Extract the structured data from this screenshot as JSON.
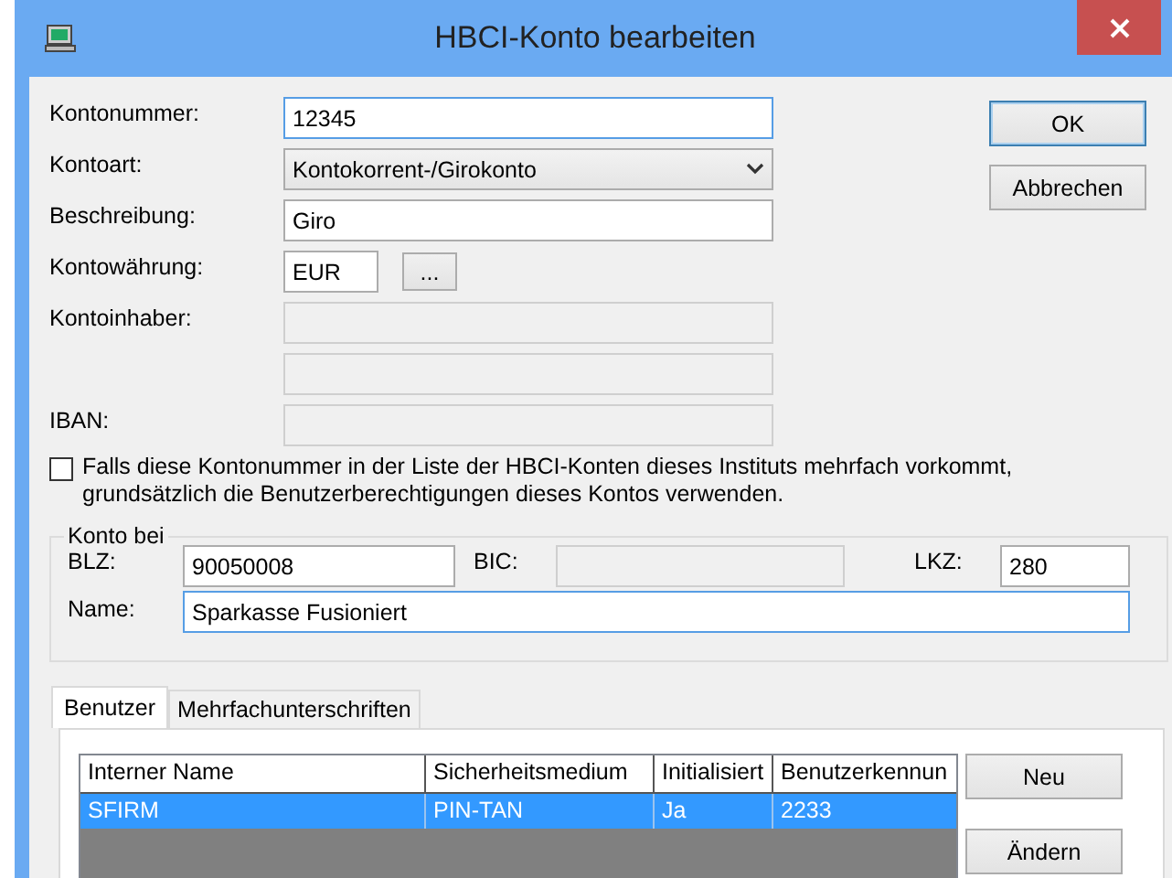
{
  "window": {
    "title": "HBCI-Konto bearbeiten"
  },
  "fields": [
    {
      "label": "Kontonummer:",
      "kind": "text",
      "value": "12345",
      "focused": true
    },
    {
      "label": "Kontoart:",
      "kind": "dropdown",
      "value": "Kontokorrent-/Girokonto",
      "focused": false
    },
    {
      "label": "Beschreibung:",
      "kind": "text",
      "value": "Giro",
      "focused": false
    },
    {
      "label": "Kontowährung:",
      "kind": "currency",
      "value": "EUR",
      "button": "...",
      "focused": false
    },
    {
      "label": "Kontoinhaber:",
      "kind": "disabled",
      "focused": false
    },
    {
      "kind": "disabled",
      "focused": false
    },
    {
      "label": "IBAN:",
      "kind": "disabled",
      "focused": false
    }
  ],
  "dialog_buttons": [
    {
      "label": "OK",
      "default": true
    },
    {
      "label": "Abbrechen",
      "default": false
    }
  ],
  "checkbox": {
    "label": "Falls diese Kontonummer in der Liste der HBCI-Konten dieses Instituts mehrfach vorkommt, grundsätzlich die Benutzerberechtigungen dieses Kontos verwenden.",
    "checked": false
  },
  "konto_bei": {
    "title": "Konto bei",
    "fields": [
      {
        "label": "BLZ:",
        "value": "90050008",
        "disabled": false,
        "focused": false
      },
      {
        "label": "BIC:",
        "disabled": true,
        "focused": false
      },
      {
        "label": "LKZ:",
        "value": "280",
        "disabled": false,
        "focused": false
      },
      {
        "label": "Name:",
        "value": "Sparkasse Fusioniert",
        "disabled": false,
        "focused": true
      }
    ]
  },
  "tabs": [
    {
      "label": "Benutzer",
      "selected": true
    },
    {
      "label": "Mehrfachunterschriften",
      "selected": false
    }
  ],
  "table": {
    "columns": [
      "Interner Name",
      "Sicherheitsmedium",
      "Initialisiert",
      "Benutzerkennun"
    ],
    "rows": [
      {
        "cells": [
          "SFIRM",
          "PIN-TAN",
          "Ja",
          "2233"
        ],
        "selected": true
      }
    ]
  },
  "side_buttons": [
    "Neu",
    "Ändern"
  ]
}
